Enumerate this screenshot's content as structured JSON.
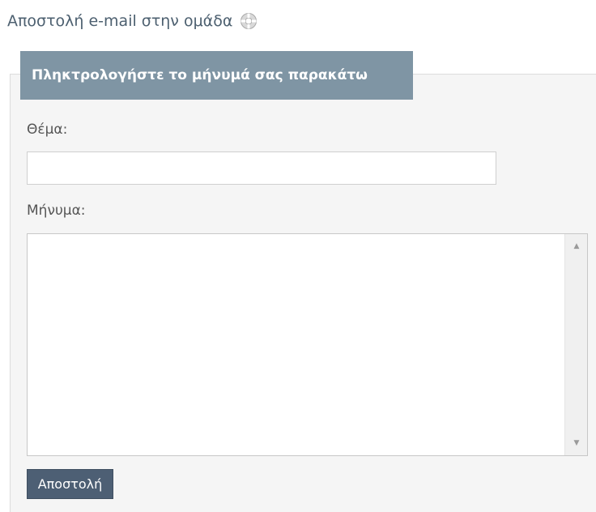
{
  "header": {
    "title": "Αποστολή e-mail στην ομάδα",
    "help_icon": "lifebuoy-help-icon"
  },
  "form": {
    "legend": "Πληκτρολογήστε το μήνυμά σας παρακάτω",
    "subject_label": "Θέμα:",
    "subject_value": "",
    "message_label": "Μήνυμα:",
    "message_value": "",
    "send_label": "Αποστολή"
  },
  "colors": {
    "title_text": "#4d6070",
    "legend_bg": "#7f95a4",
    "panel_bg": "#f5f5f5",
    "button_bg": "#4d5f74"
  }
}
